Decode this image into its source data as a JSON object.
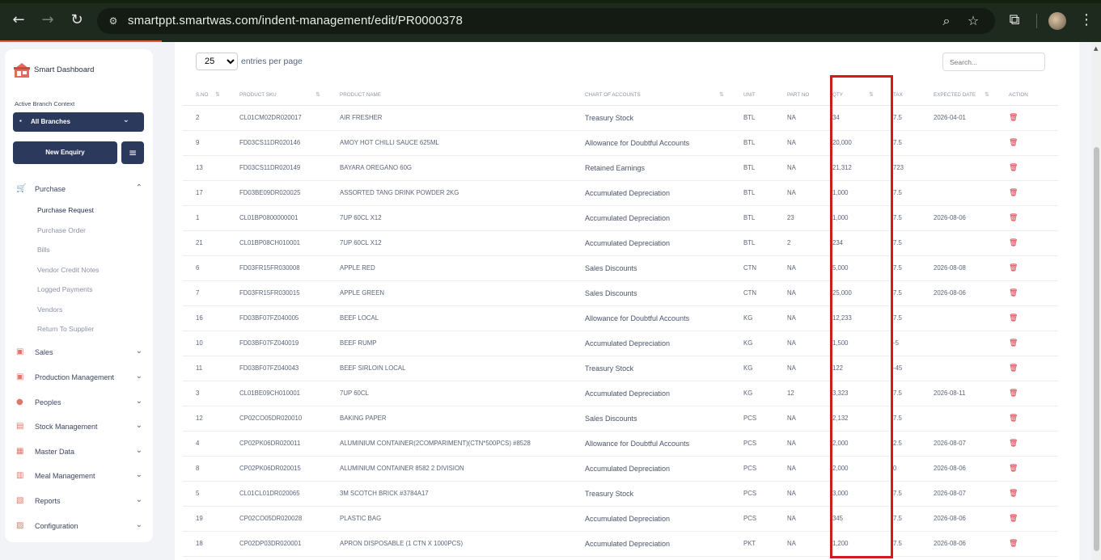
{
  "browser": {
    "url": "smartppt.smartwas.com/indent-management/edit/PR0000378",
    "icons": [
      "back-icon",
      "forward-icon",
      "reload-icon",
      "site-info-icon",
      "zoom-icon",
      "bookmark-star-icon",
      "extensions-icon",
      "profile-avatar",
      "more-menu-icon"
    ]
  },
  "sidebar": {
    "brand": "Smart Dashboard",
    "branch_label": "Active Branch Context",
    "branch_value": "All Branches",
    "new_enquiry": "New Enquiry",
    "nav": [
      {
        "label": "Purchase",
        "icon": "cart-icon",
        "expanded": true
      },
      {
        "label": "Sales",
        "icon": "sales-icon"
      },
      {
        "label": "Production Management",
        "icon": "production-icon"
      },
      {
        "label": "Peoples",
        "icon": "people-icon"
      },
      {
        "label": "Stock Management",
        "icon": "stock-icon"
      },
      {
        "label": "Master Data",
        "icon": "master-data-icon"
      },
      {
        "label": "Meal Management",
        "icon": "meal-icon"
      },
      {
        "label": "Reports",
        "icon": "reports-icon"
      },
      {
        "label": "Configuration",
        "icon": "configuration-icon"
      }
    ],
    "purchase_sub": [
      "Purchase Request",
      "Purchase Order",
      "Bills",
      "Vendor Credit Notes",
      "Logged Payments",
      "Vendors",
      "Return To Supplier"
    ]
  },
  "table_controls": {
    "entries_value": "25",
    "entries_text": "entries per page",
    "search_placeholder": "Search..."
  },
  "table": {
    "headers": [
      "S.NO",
      "PRODUCT SKU",
      "PRODUCT NAME",
      "CHART OF ACCOUNTS",
      "UNIT",
      "PART NO",
      "QTY",
      "TAX",
      "EXPECTED DATE",
      "ACTION"
    ],
    "rows": [
      [
        "2",
        "CL01CM02DR020017",
        "AIR FRESHER",
        "Treasury Stock",
        "BTL",
        "NA",
        "34",
        "7.5",
        "2026-04-01"
      ],
      [
        "9",
        "FD03CS11DR020146",
        "AMOY HOT CHILLI SAUCE 625ML",
        "Allowance for Doubtful Accounts",
        "BTL",
        "NA",
        "20,000",
        "7.5",
        ""
      ],
      [
        "13",
        "FD03CS11DR020149",
        "BAYARA OREGANO 60G",
        "Retained Earnings",
        "BTL",
        "NA",
        "21,312",
        "723",
        ""
      ],
      [
        "17",
        "FD03BE09DR020025",
        "ASSORTED TANG DRINK POWDER 2KG",
        "Accumulated Depreciation",
        "BTL",
        "NA",
        "1,000",
        "7.5",
        ""
      ],
      [
        "1",
        "CL01BP0800000001",
        "7UP 60CL X12",
        "Accumulated Depreciation",
        "BTL",
        "23",
        "1,000",
        "7.5",
        "2026-08-06"
      ],
      [
        "21",
        "CL01BP08CH010001",
        "7UP 60CL X12",
        "Accumulated Depreciation",
        "BTL",
        "2",
        "234",
        "7.5",
        ""
      ],
      [
        "6",
        "FD03FR15FR030008",
        "APPLE RED",
        "Sales Discounts",
        "CTN",
        "NA",
        "5,000",
        "7.5",
        "2026-08-08"
      ],
      [
        "7",
        "FD03FR15FR030015",
        "APPLE GREEN",
        "Sales Discounts",
        "CTN",
        "NA",
        "25,000",
        "7.5",
        "2026-08-06"
      ],
      [
        "16",
        "FD03BF07FZ040005",
        "BEEF LOCAL",
        "Allowance for Doubtful Accounts",
        "KG",
        "NA",
        "12,233",
        "7.5",
        ""
      ],
      [
        "10",
        "FD03BF07FZ040019",
        "BEEF RUMP",
        "Accumulated Depreciation",
        "KG",
        "NA",
        "1,500",
        "-5",
        ""
      ],
      [
        "11",
        "FD03BF07FZ040043",
        "BEEF SIRLOIN LOCAL",
        "Treasury Stock",
        "KG",
        "NA",
        "122",
        "-45",
        ""
      ],
      [
        "3",
        "CL01BE09CH010001",
        "7UP 60CL",
        "Accumulated Depreciation",
        "KG",
        "12",
        "3,323",
        "7.5",
        "2026-08-11"
      ],
      [
        "12",
        "CP02CO05DR020010",
        "BAKING PAPER",
        "Sales Discounts",
        "PCS",
        "NA",
        "2,132",
        "7.5",
        ""
      ],
      [
        "4",
        "CP02PK06DR020011",
        "ALUMINIUM CONTAINER(2COMPARIMENT)(CTN*500PCS) #8528",
        "Allowance for Doubtful Accounts",
        "PCS",
        "NA",
        "2,000",
        "2.5",
        "2026-08-07"
      ],
      [
        "8",
        "CP02PK06DR020015",
        "ALUMINIUM CONTAINER 8582 2 DIVISION",
        "Accumulated Depreciation",
        "PCS",
        "NA",
        "2,000",
        "0",
        "2026-08-06"
      ],
      [
        "5",
        "CL01CL01DR020065",
        "3M SCOTCH BRICK #3784A17",
        "Treasury Stock",
        "PCS",
        "NA",
        "3,000",
        "7.5",
        "2026-08-07"
      ],
      [
        "19",
        "CP02CO05DR020028",
        "PLASTIC BAG",
        "Accumulated Depreciation",
        "PCS",
        "NA",
        "345",
        "7.5",
        "2026-08-06"
      ],
      [
        "18",
        "CP02DP03DR020001",
        "APRON DISPOSABLE (1 CTN X 1000PCS)",
        "Accumulated Depreciation",
        "PKT",
        "NA",
        "1,200",
        "7.5",
        "2026-08-06"
      ]
    ]
  },
  "colors": {
    "accent": "#2b3a5c",
    "highlight_box": "#d2191f",
    "delete_icon": "#e0293b"
  }
}
